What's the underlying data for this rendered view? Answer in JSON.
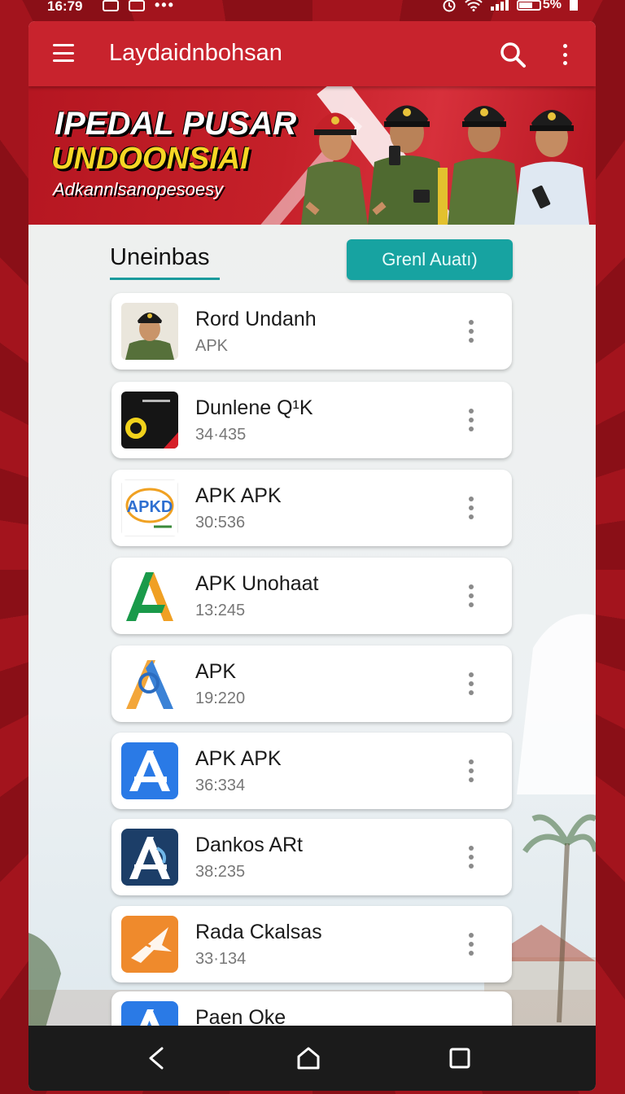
{
  "status_bar": {
    "time": "16:79",
    "battery_text": "5%",
    "icons": [
      "image-icon",
      "image-icon",
      "more-dots-icon",
      "alarm-icon",
      "wifi-icon",
      "signal-icon",
      "battery-icon"
    ]
  },
  "app_bar": {
    "title": "Laydaidnbohsan",
    "icons": [
      "menu-icon",
      "search-icon",
      "more-vert-icon"
    ],
    "color": "#c8232d"
  },
  "banner": {
    "line1": "IPEDAL PUSAR",
    "line2": "UNDOONSIAI",
    "line3": "Adkannlsanopesoesy"
  },
  "section": {
    "title": "Uneinbas",
    "action_label": "Grenl Auatı)",
    "accent": "#17a3a1"
  },
  "apps": [
    {
      "name": "Rord Undanh",
      "sub": "APK",
      "icon": "soldier-portrait-icon"
    },
    {
      "name": "Dunlene Q¹K",
      "sub": "34·435",
      "icon": "black-yellow-app-icon"
    },
    {
      "name": "APK APK",
      "sub": "30:536",
      "icon": "apkd-logo-icon"
    },
    {
      "name": "APK Unohaat",
      "sub": "13:245",
      "icon": "green-a-logo-icon"
    },
    {
      "name": "APK",
      "sub": "19:220",
      "icon": "a-magnifier-logo-icon"
    },
    {
      "name": "APK APK",
      "sub": "36:334",
      "icon": "blue-a-logo-icon"
    },
    {
      "name": "Dankos ARt",
      "sub": "38:235",
      "icon": "navy-a-logo-icon"
    },
    {
      "name": "Rada Ckalsas",
      "sub": "33·134",
      "icon": "orange-plane-logo-icon"
    },
    {
      "name": "Paen Oke",
      "sub": "",
      "icon": "blue-a-logo-icon"
    }
  ],
  "nav_bar": {
    "icons": [
      "back-icon",
      "home-icon",
      "recents-icon"
    ]
  }
}
